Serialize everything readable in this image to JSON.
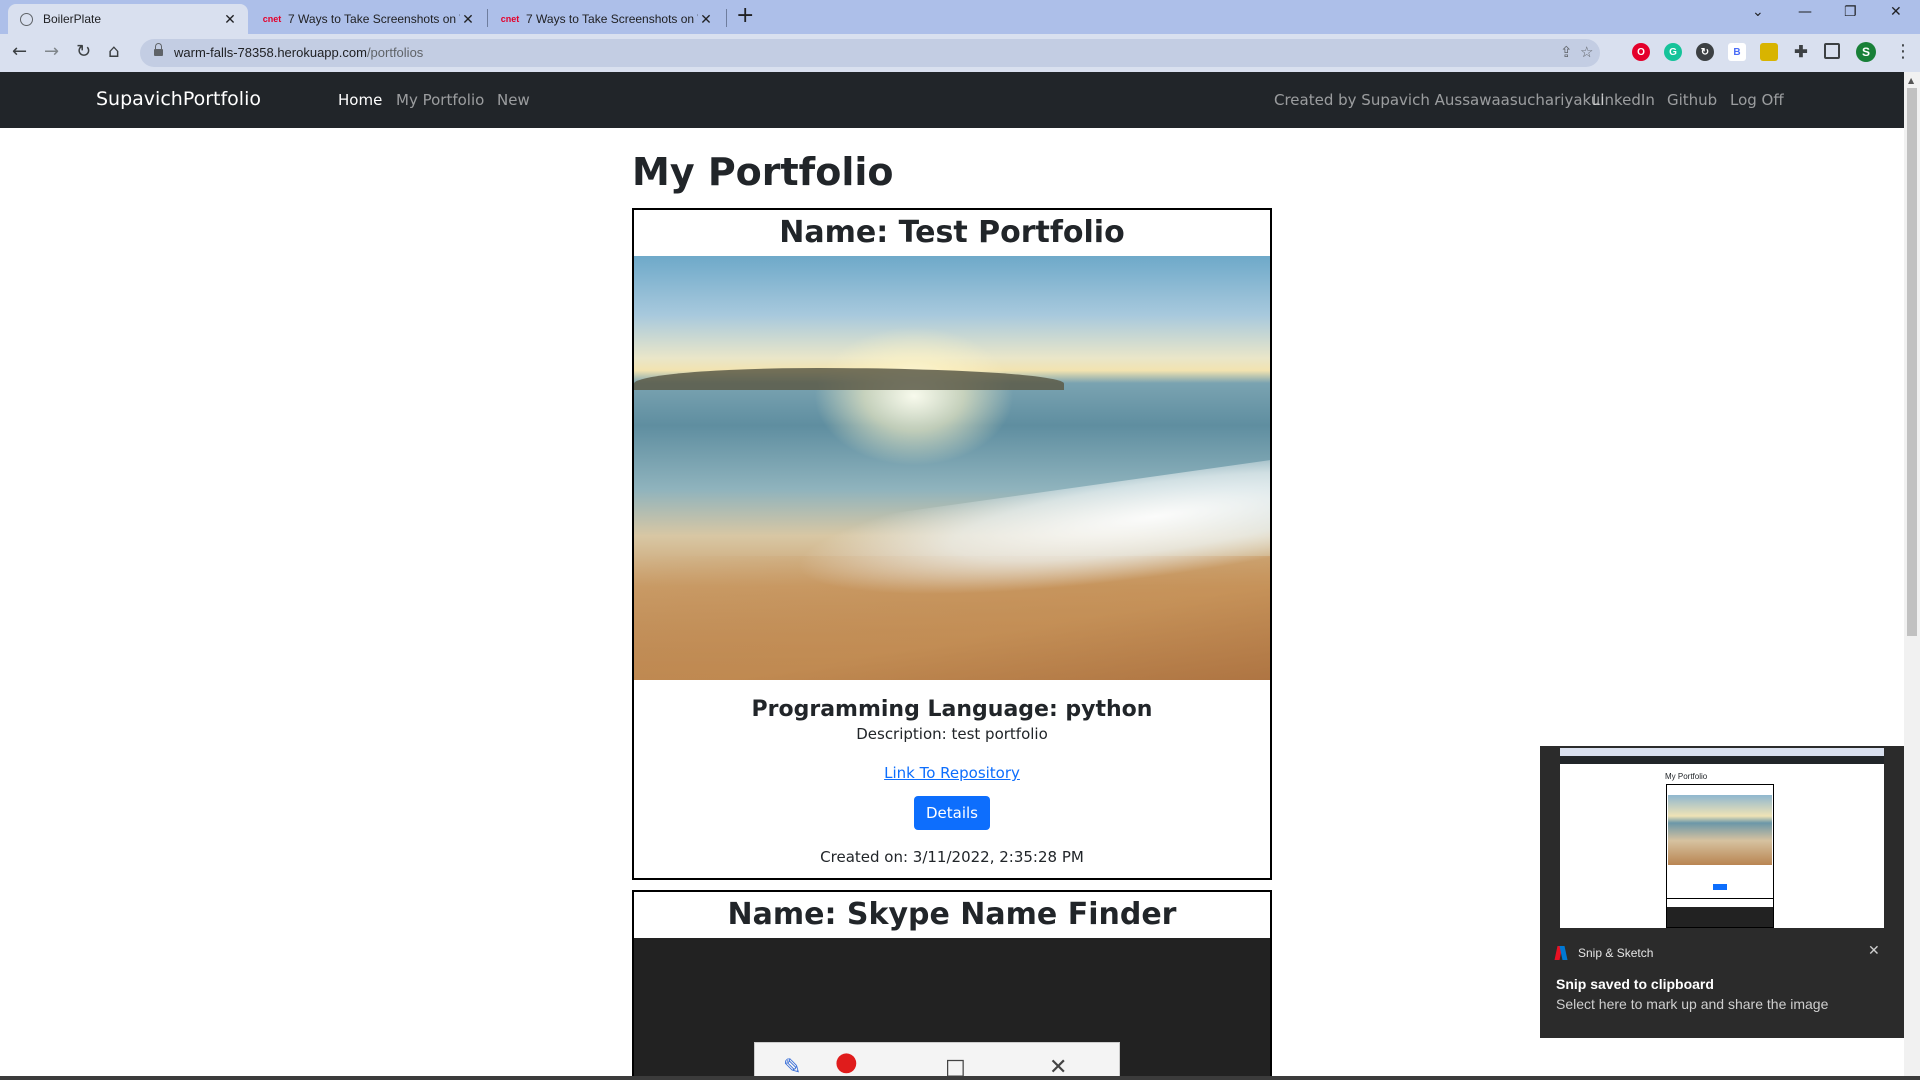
{
  "browser": {
    "tabs": [
      {
        "title": "BoilerPlate",
        "favicon": "globe-icon",
        "active": true
      },
      {
        "title": "7 Ways to Take Screenshots on W",
        "favicon": "cnet",
        "active": false
      },
      {
        "title": "7 Ways to Take Screenshots on W",
        "favicon": "cnet",
        "active": false
      }
    ],
    "cnet_label": "cnet",
    "url_host": "warm-falls-78358.herokuapp.com",
    "url_path": "/portfolios",
    "profile_initial": "S",
    "extension_b_label": "B"
  },
  "navbar": {
    "brand": "SupavichPortfolio",
    "links": [
      {
        "label": "Home",
        "active": true
      },
      {
        "label": "My Portfolio",
        "active": false
      },
      {
        "label": "New",
        "active": false
      }
    ],
    "right_links": [
      {
        "label": "Created by Supavich Aussawaasuchariyakul"
      },
      {
        "label": "LinkedIn"
      },
      {
        "label": "Github"
      },
      {
        "label": "Log Off"
      }
    ]
  },
  "page": {
    "title": "My Portfolio",
    "portfolios": [
      {
        "name": "Name: Test Portfolio",
        "language": "Programming Language: python",
        "description": "Description: test portfolio",
        "repo_link": "Link To Repository",
        "details_label": "Details",
        "created": "Created on: 3/11/2022, 2:35:28 PM"
      },
      {
        "name": "Name: Skype Name Finder"
      }
    ]
  },
  "toast": {
    "app": "Snip & Sketch",
    "heading": "Snip saved to clipboard",
    "subtext": "Select here to mark up and share the image",
    "thumb_title": "My Portfolio"
  },
  "colors": {
    "navbar_bg": "#212529",
    "link_blue": "#0d6efd",
    "tabstrip_bg": "#adbfe9",
    "toolbar_bg": "#d9e0ef",
    "toast_bg": "#2b2b2b"
  }
}
